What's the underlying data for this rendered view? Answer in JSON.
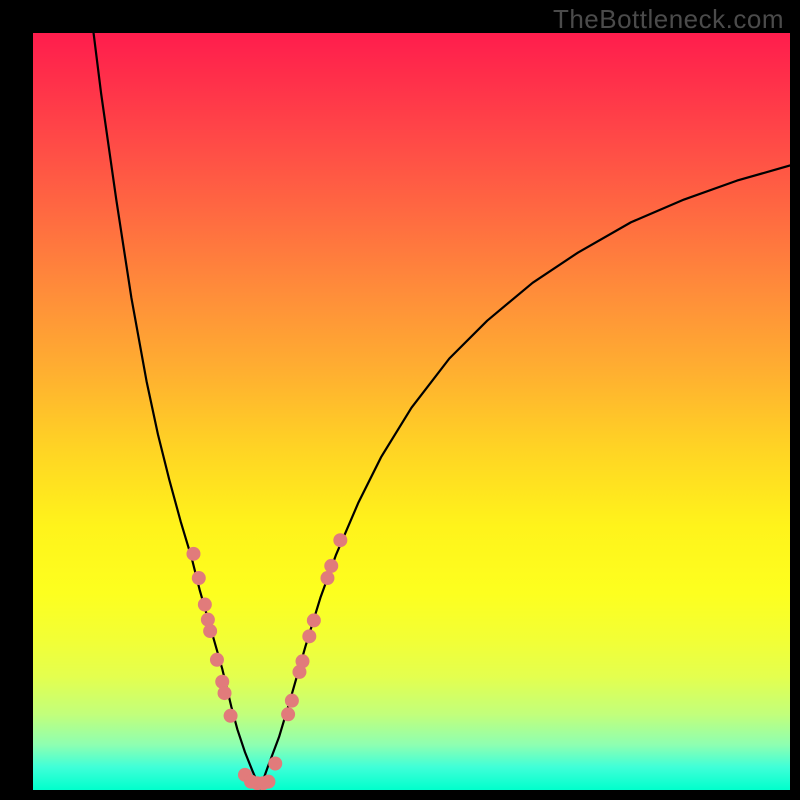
{
  "watermark": "TheBottleneck.com",
  "chart_data": {
    "type": "line",
    "title": "",
    "xlabel": "",
    "ylabel": "",
    "xlim": [
      0,
      100
    ],
    "ylim": [
      0,
      100
    ],
    "grid": false,
    "series": [
      {
        "name": "left-branch",
        "x": [
          8,
          9,
          11,
          13,
          15,
          16.5,
          18,
          19.5,
          21,
          22,
          23,
          24,
          25,
          25.6,
          26.2,
          27,
          28,
          29,
          30
        ],
        "y": [
          100,
          92,
          78,
          65,
          54,
          47,
          41,
          35.5,
          30.5,
          26.5,
          23,
          19.5,
          16,
          13.5,
          11,
          8,
          5,
          2.5,
          0.2
        ]
      },
      {
        "name": "right-branch",
        "x": [
          30,
          31,
          32.5,
          34,
          36,
          38,
          40,
          43,
          46,
          50,
          55,
          60,
          66,
          72,
          79,
          86,
          93,
          100
        ],
        "y": [
          0.2,
          3,
          7,
          12,
          19,
          25.5,
          31,
          38,
          44,
          50.5,
          57,
          62,
          67,
          71,
          75,
          78,
          80.5,
          82.5
        ]
      }
    ],
    "markers": {
      "name": "highlight-dots",
      "color": "#e17b7b",
      "points": [
        {
          "x": 21.2,
          "y": 31.2
        },
        {
          "x": 21.9,
          "y": 28.0
        },
        {
          "x": 22.7,
          "y": 24.5
        },
        {
          "x": 23.1,
          "y": 22.5
        },
        {
          "x": 23.4,
          "y": 21.0
        },
        {
          "x": 24.3,
          "y": 17.2
        },
        {
          "x": 25.0,
          "y": 14.3
        },
        {
          "x": 25.3,
          "y": 12.8
        },
        {
          "x": 26.1,
          "y": 9.8
        },
        {
          "x": 28.0,
          "y": 2.0
        },
        {
          "x": 28.8,
          "y": 1.1
        },
        {
          "x": 29.6,
          "y": 0.9
        },
        {
          "x": 30.4,
          "y": 0.9
        },
        {
          "x": 31.1,
          "y": 1.1
        },
        {
          "x": 32.0,
          "y": 3.5
        },
        {
          "x": 33.7,
          "y": 10.0
        },
        {
          "x": 34.2,
          "y": 11.8
        },
        {
          "x": 35.2,
          "y": 15.6
        },
        {
          "x": 35.6,
          "y": 17.0
        },
        {
          "x": 36.5,
          "y": 20.3
        },
        {
          "x": 37.1,
          "y": 22.4
        },
        {
          "x": 38.9,
          "y": 28.0
        },
        {
          "x": 39.4,
          "y": 29.6
        },
        {
          "x": 40.6,
          "y": 33.0
        }
      ]
    }
  }
}
